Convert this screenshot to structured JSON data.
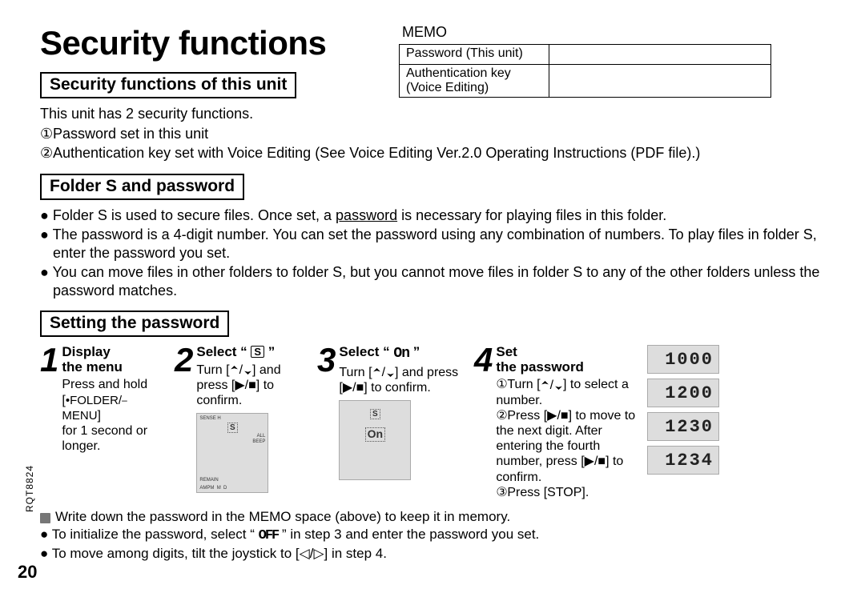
{
  "title": "Security functions",
  "memo": {
    "label": "MEMO",
    "rows": [
      [
        "Password (This unit)",
        ""
      ],
      [
        "Authentication key (Voice Editing)",
        ""
      ]
    ]
  },
  "section1": {
    "heading": "Security functions of this unit",
    "intro": "This unit has 2 security functions.",
    "item1": "Password set in this unit",
    "item2": "Authentication key set with Voice Editing (See Voice Editing Ver.2.0 Operating Instructions (PDF file).)"
  },
  "section2": {
    "heading": "Folder S and password",
    "b1a": "Folder S is used to secure files. Once set, a ",
    "b1u": "password",
    "b1b": " is necessary for playing files in this folder.",
    "b2": "The password is a 4-digit number. You can set the password using any combination of numbers. To play files in folder S, enter the password you set.",
    "b3": "You can move files in other folders to folder S, but you cannot move files in folder S to any of the other folders unless the password matches."
  },
  "section3": {
    "heading": "Setting the password",
    "steps": {
      "s1": {
        "title1": "Display",
        "title2": "the menu",
        "desc": "Press and hold [•FOLDER/– MENU] for 1 second or longer."
      },
      "s2": {
        "title": "Select “ S ”",
        "descA": "Turn [",
        "descB": "] and press [",
        "descC": "] to confirm."
      },
      "s3": {
        "title": "Select “ On ”",
        "descA": "Turn [",
        "descB": "] and press [",
        "descC": "] to confirm."
      },
      "s4": {
        "title1": "Set",
        "title2": "the password",
        "l1a": "Turn [",
        "l1b": "] to select a number.",
        "l2a": "Press [",
        "l2b": "] to move to the next digit. After entering the fourth number, press [",
        "l2c": "] to confirm.",
        "l3": "Press [STOP]."
      }
    },
    "lcd": [
      "1000",
      "1200",
      "1230",
      "1234"
    ]
  },
  "notes": {
    "n1": "Write down the password in the MEMO space (above) to keep it in memory.",
    "n2a": "To initialize the password, select “ ",
    "n2b": " ” in step 3 and enter the password you set.",
    "n3": "To move among digits, tilt the joystick to [◁/▷] in step 4."
  },
  "pageNumber": "20",
  "docCode": "RQT8824",
  "glyphs": {
    "off": "OFF"
  }
}
